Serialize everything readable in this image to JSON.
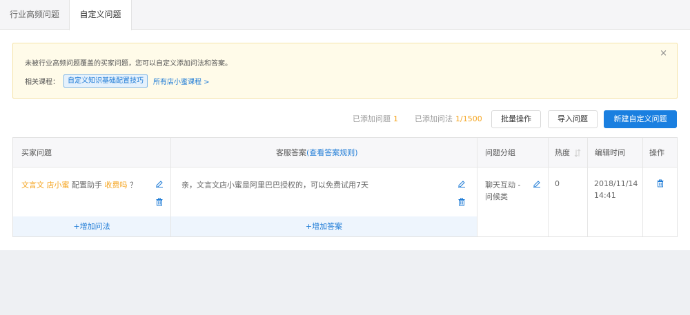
{
  "tabs": [
    {
      "label": "行业高频问题"
    },
    {
      "label": "自定义问题"
    }
  ],
  "notice": {
    "text": "未被行业高频问题覆盖的买家问题，您可以自定义添加问法和答案。",
    "related_label": "相关课程：",
    "course_chip": "自定义知识基础配置技巧",
    "all_courses": "所有店小蜜课程 >",
    "close": "×"
  },
  "stats": {
    "questions_label": "已添加问题",
    "questions_value": "1",
    "phrasings_label": "已添加问法",
    "phrasings_value": "1/1500"
  },
  "toolbar": {
    "batch_label": "批量操作",
    "import_label": "导入问题",
    "new_label": "新建自定义问题"
  },
  "table": {
    "headers": {
      "question": "买家问题",
      "answer_prefix": "客服答案",
      "answer_link": "(查看答案规则)",
      "group": "问题分组",
      "heat": "热度",
      "edit_time": "编辑时间",
      "action": "操作"
    },
    "rows": [
      {
        "q_part1": "文言文 店小蜜",
        "q_part2": " 配置助手 ",
        "q_part3": "收费吗",
        "q_part4": " ？",
        "answer": "亲，文言文店小蜜是阿里巴巴授权的，可以免费试用7天",
        "group_line1": "聊天互动 -",
        "group_line2": "问候类",
        "heat": "0",
        "time_line1": "2018/11/14",
        "time_line2": "14:41"
      }
    ],
    "add_phrasing": "+增加问法",
    "add_answer": "+增加答案"
  },
  "colors": {
    "accent": "#1a7fe0",
    "highlight": "#f5a623",
    "notice_bg": "#fffbe9"
  }
}
